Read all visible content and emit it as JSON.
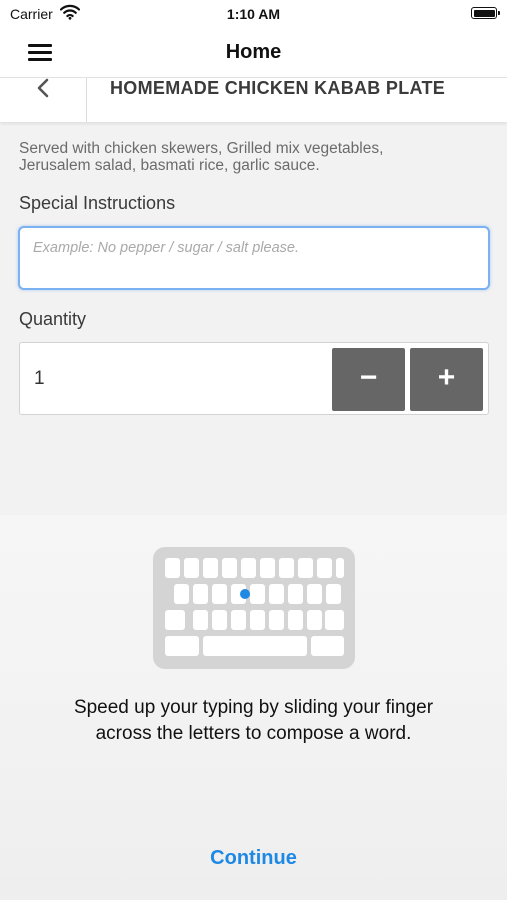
{
  "status_bar": {
    "carrier": "Carrier",
    "time": "1:10 AM"
  },
  "nav": {
    "title": "Home",
    "menu_icon": "hamburger-menu-icon"
  },
  "item": {
    "title": "HOMEMADE CHICKEN KABAB PLATE",
    "back_icon": "chevron-left-icon",
    "description_line1": "Served with chicken skewers, Grilled mix vegetables,",
    "description_line2": "Jerusalem salad, basmati rice, garlic sauce."
  },
  "special_instructions": {
    "label": "Special Instructions",
    "placeholder": "Example: No pepper / sugar / salt please.",
    "value": ""
  },
  "quantity": {
    "label": "Quantity",
    "value": "1",
    "minus_label": "−",
    "plus_label": "+"
  },
  "keyboard_tip": {
    "line1": "Speed up your typing by sliding your finger",
    "line2": "across the letters to compose a word.",
    "continue_label": "Continue"
  },
  "colors": {
    "accent": "#1e88e5",
    "input_focus_border": "#7ab1f0",
    "stepper_button": "#666666"
  }
}
